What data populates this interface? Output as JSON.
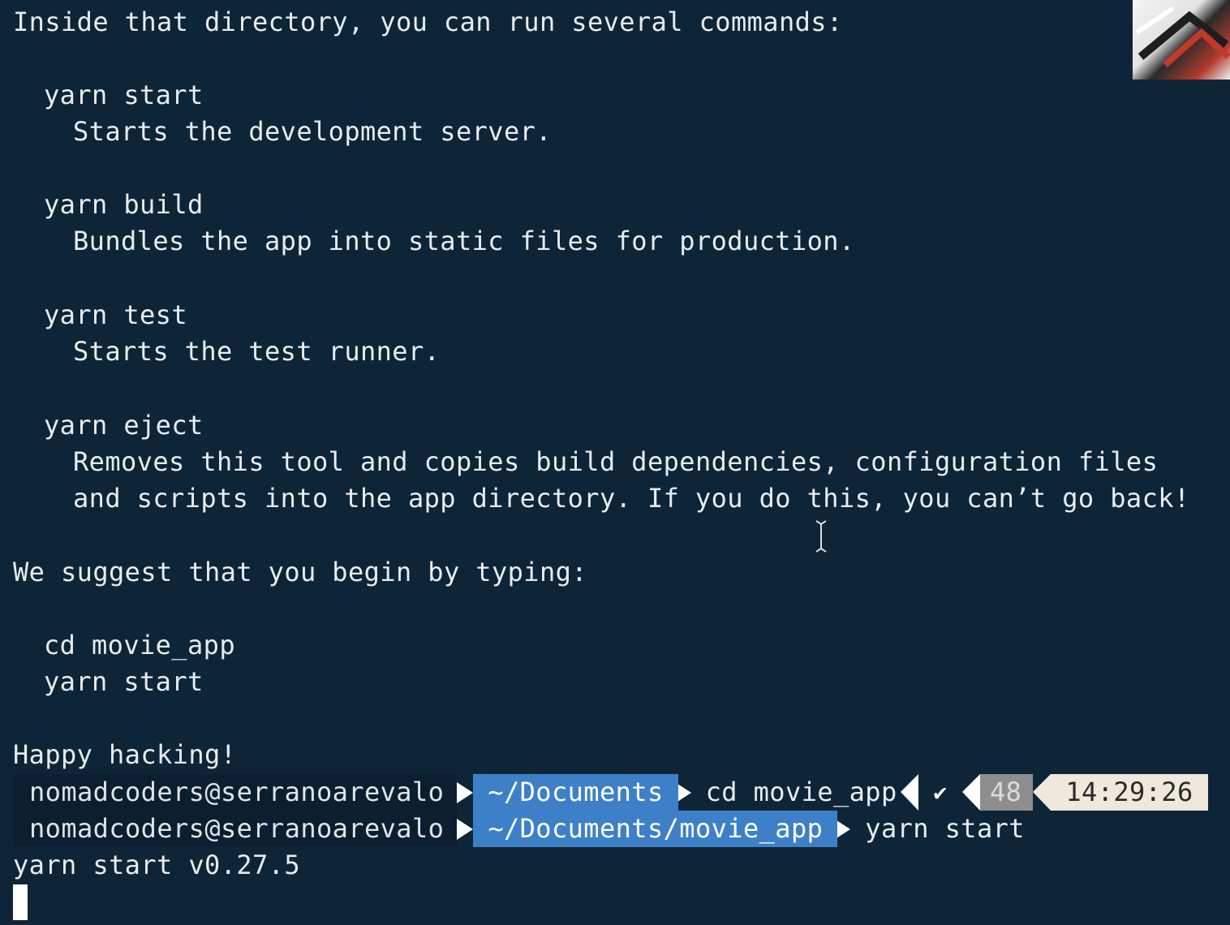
{
  "terminal": {
    "intro": "Inside that directory, you can run several commands:",
    "commands": [
      {
        "cmd": "yarn start",
        "desc": [
          "Starts the development server."
        ]
      },
      {
        "cmd": "yarn build",
        "desc": [
          "Bundles the app into static files for production."
        ]
      },
      {
        "cmd": "yarn test",
        "desc": [
          "Starts the test runner."
        ]
      },
      {
        "cmd": "yarn eject",
        "desc": [
          "Removes this tool and copies build dependencies, configuration files",
          "and scripts into the app directory. If you do this, you can’t go back!"
        ]
      }
    ],
    "suggest": "We suggest that you begin by typing:",
    "suggested_cmds": [
      "cd movie_app",
      "yarn start"
    ],
    "farewell": "Happy hacking!",
    "output_line": "yarn start v0.27.5"
  },
  "prompts": [
    {
      "user": "nomadcoders@serranoarevalo",
      "dir": "~/Documents",
      "command": "cd movie_app"
    },
    {
      "user": "nomadcoders@serranoarevalo",
      "dir": "~/Documents/movie_app",
      "command": "yarn start"
    }
  ],
  "status": {
    "check": "✔",
    "count": "48",
    "time": "14:29:26"
  },
  "colors": {
    "background": "#0e2538",
    "dir_segment": "#3d80c8",
    "count_segment": "#8e8e8e",
    "time_segment": "#efe8dc"
  }
}
